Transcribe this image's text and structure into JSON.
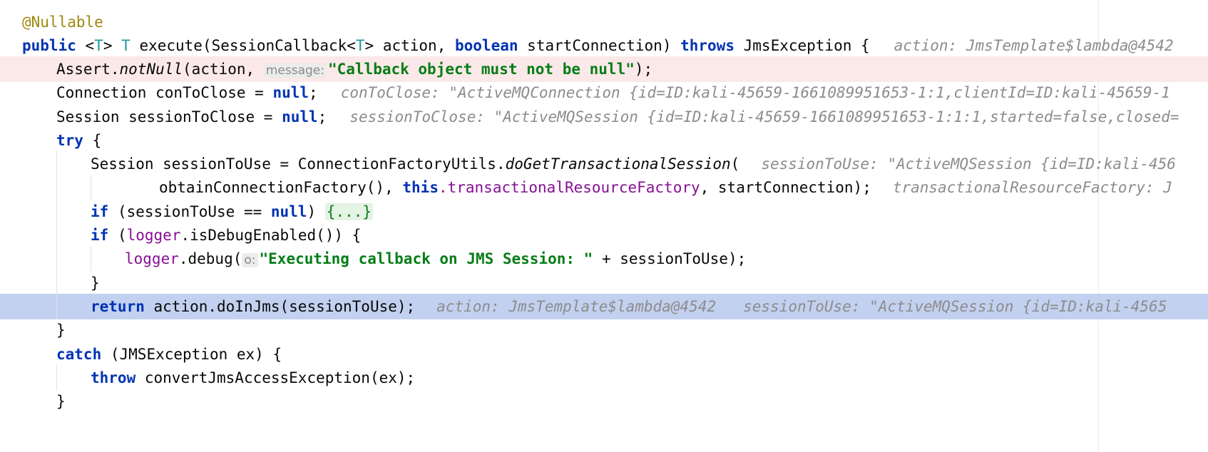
{
  "editor": {
    "lines": [
      {
        "annotation": "@Nullable"
      },
      {
        "kw_public": "public",
        "lt": "<",
        "type_param": "T",
        "gt": ">",
        "ret_type": "T",
        "method": "execute(SessionCallback<",
        "type_param2": "T",
        "args": "> action,",
        "kw_boolean": "boolean",
        "args2": "startConnection)",
        "kw_throws": "throws",
        "exc": "JmsException {",
        "inline": "action: JmsTemplate$lambda@4542"
      },
      {
        "pre": "Assert.",
        "method": "notNull",
        "args": "(action,",
        "hint": "message:",
        "str": "\"Callback object must not be null\"",
        "post": ");"
      },
      {
        "pre": "Connection conToClose =",
        "kw_null": "null",
        "post": ";",
        "inline": "conToClose: \"ActiveMQConnection {id=ID:kali-45659-1661089951653-1:1,clientId=ID:kali-45659-1"
      },
      {
        "pre": "Session sessionToClose =",
        "kw_null": "null",
        "post": ";",
        "inline": "sessionToClose: \"ActiveMQSession {id=ID:kali-45659-1661089951653-1:1:1,started=false,closed="
      },
      {
        "kw_try": "try",
        "post": "{"
      },
      {
        "pre": "Session sessionToUse = ConnectionFactoryUtils.",
        "method": "doGetTransactionalSession",
        "post": "(",
        "inline": "sessionToUse: \"ActiveMQSession {id=ID:kali-456"
      },
      {
        "pre": "obtainConnectionFactory(),",
        "kw_this": "this",
        "field": ".transactionalResourceFactory",
        "post": ", startConnection);",
        "inline": "transactionalResourceFactory: J"
      },
      {
        "kw_if": "if",
        "pre": "(sessionToUse ==",
        "kw_null": "null",
        "post": ")",
        "fold": "{...}"
      },
      {
        "kw_if": "if",
        "pre": "(",
        "field": "logger",
        "post": ".isDebugEnabled()) {"
      },
      {
        "field": "logger",
        "pre": ".debug(",
        "hint": "o:",
        "str": "\"Executing callback on JMS Session: \"",
        "post": "+ sessionToUse);"
      },
      {
        "text": "}"
      },
      {
        "kw_return": "return",
        "post": "action.doInJms(sessionToUse);",
        "inline": "action: JmsTemplate$lambda@4542",
        "inline2": "sessionToUse: \"ActiveMQSession {id=ID:kali-4565"
      },
      {
        "text": "}"
      },
      {
        "kw_catch": "catch",
        "post": "(JMSException ex) {"
      },
      {
        "kw_throw": "throw",
        "post": "convertJmsAccessException(ex);"
      },
      {
        "text": "}"
      }
    ]
  }
}
